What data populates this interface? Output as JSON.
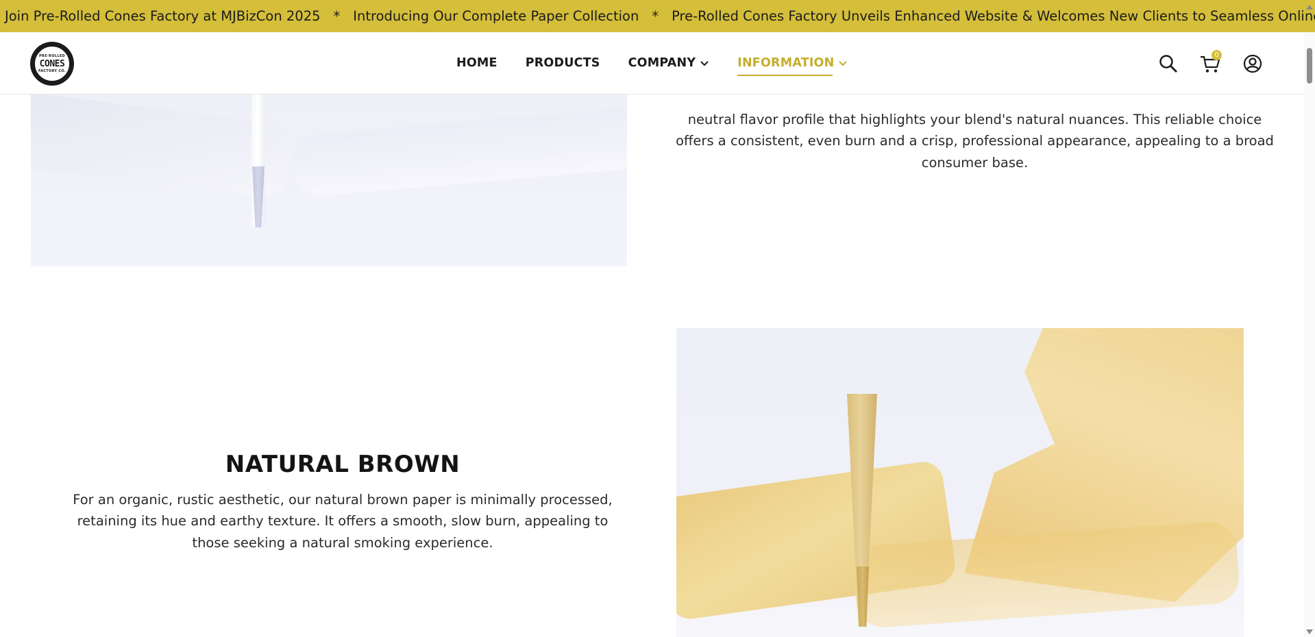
{
  "ticker": {
    "items": [
      "Join Pre-Rolled Cones Factory at MJBizCon 2025",
      "Introducing Our Complete Paper Collection",
      "Pre-Rolled Cones Factory Unveils Enhanced Website & Welcomes New Clients to Seamless Online Ordering!"
    ],
    "separator": "*",
    "background": "#d4be3a"
  },
  "header": {
    "logo": {
      "top_text": "PRE-ROLLED",
      "main_text": "CONES",
      "bottom_text": "FACTORY CO."
    },
    "nav": [
      {
        "label": "HOME",
        "has_dropdown": false,
        "active": false
      },
      {
        "label": "PRODUCTS",
        "has_dropdown": false,
        "active": false
      },
      {
        "label": "COMPANY",
        "has_dropdown": true,
        "active": false
      },
      {
        "label": "INFORMATION",
        "has_dropdown": true,
        "active": true
      }
    ],
    "cart_count": "0",
    "icons": [
      "search-icon",
      "cart-icon",
      "account-icon"
    ],
    "accent_color": "#c4ae2a"
  },
  "content": {
    "top_paragraph": "neutral flavor profile that highlights your blend's natural nuances. This reliable choice offers a consistent, even burn and a crisp, professional appearance, appealing to a broad consumer base.",
    "section": {
      "title": "NATURAL BROWN",
      "description": "For an organic, rustic aesthetic, our natural brown paper is minimally processed, retaining its hue and earthy texture. It offers a smooth, slow burn, appealing to those seeking a natural smoking experience."
    }
  }
}
